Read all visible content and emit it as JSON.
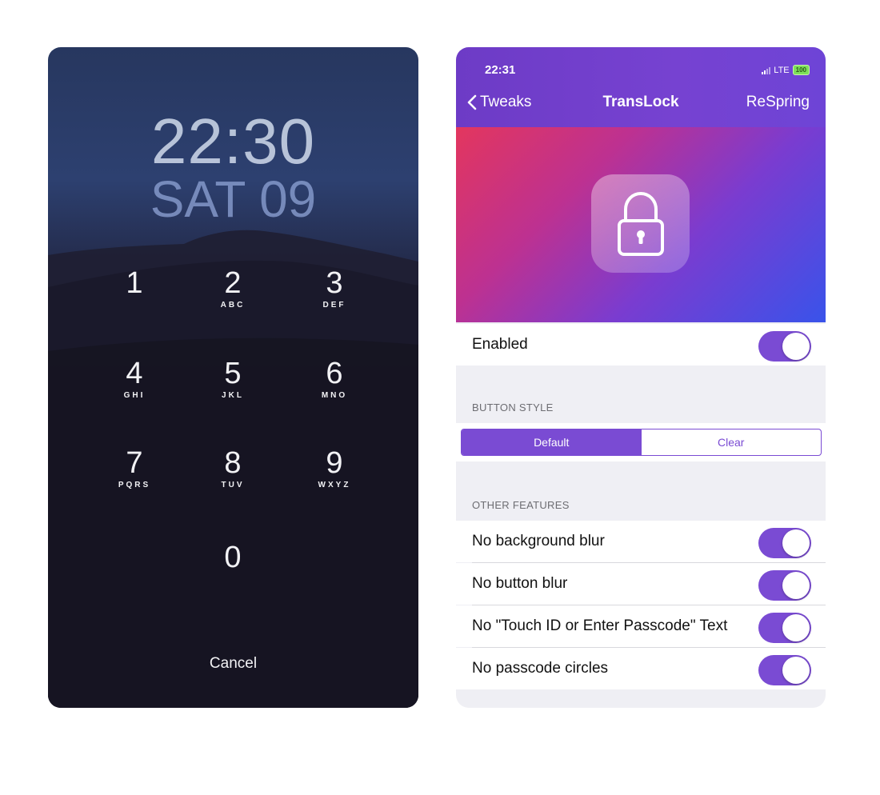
{
  "lock_screen": {
    "time": "22:30",
    "date": "SAT 09",
    "keypad": [
      {
        "digit": "1",
        "letters": ""
      },
      {
        "digit": "2",
        "letters": "ABC"
      },
      {
        "digit": "3",
        "letters": "DEF"
      },
      {
        "digit": "4",
        "letters": "GHI"
      },
      {
        "digit": "5",
        "letters": "JKL"
      },
      {
        "digit": "6",
        "letters": "MNO"
      },
      {
        "digit": "7",
        "letters": "PQRS"
      },
      {
        "digit": "8",
        "letters": "TUV"
      },
      {
        "digit": "9",
        "letters": "WXYZ"
      },
      {
        "digit": "0",
        "letters": ""
      }
    ],
    "cancel_label": "Cancel"
  },
  "settings": {
    "status_bar": {
      "time": "22:31",
      "network": "LTE",
      "battery": "100"
    },
    "nav": {
      "back_label": "Tweaks",
      "title": "TransLock",
      "action_label": "ReSpring"
    },
    "enabled": {
      "label": "Enabled",
      "on": true
    },
    "button_style": {
      "header": "BUTTON STYLE",
      "options": [
        "Default",
        "Clear"
      ],
      "selected": "Default"
    },
    "other_features": {
      "header": "OTHER FEATURES",
      "items": [
        {
          "label": "No background blur",
          "on": true
        },
        {
          "label": "No button blur",
          "on": true
        },
        {
          "label": "No \"Touch ID or Enter Passcode\" Text",
          "on": true
        },
        {
          "label": "No passcode circles",
          "on": true
        }
      ]
    },
    "colors": {
      "accent": "#7a4bd3",
      "nav_bar": "#7642d1",
      "banner_start": "#e3365e",
      "banner_end": "#3953ea"
    },
    "icons": [
      "back-chevron-icon",
      "signal-icon",
      "battery-icon",
      "padlock-icon"
    ]
  }
}
